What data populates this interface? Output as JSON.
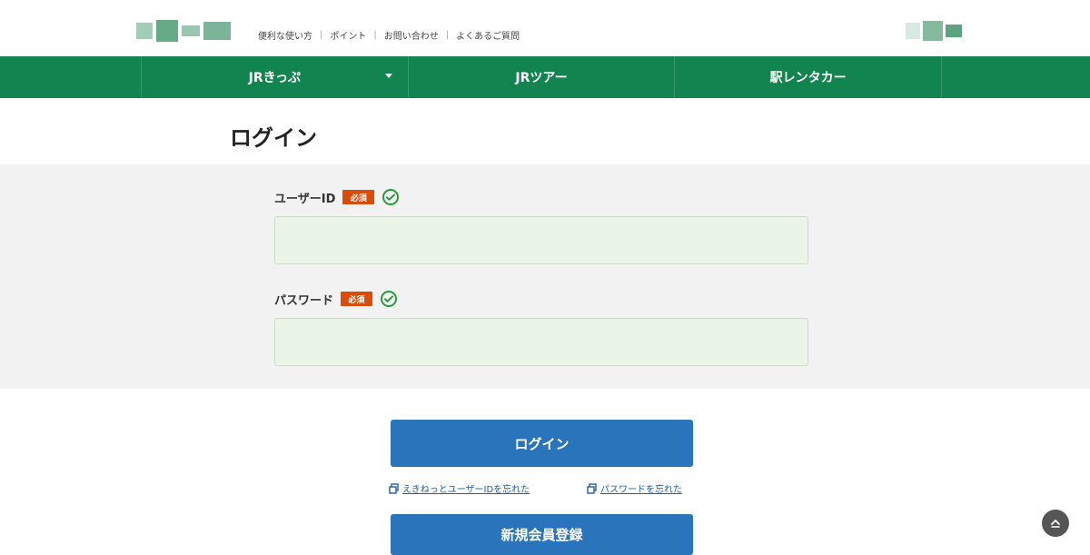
{
  "header": {
    "utility_links": [
      {
        "label": "便利な使い方"
      },
      {
        "label": "ポイント"
      },
      {
        "label": "お問い合わせ"
      },
      {
        "label": "よくあるご質問"
      }
    ]
  },
  "nav": {
    "items": [
      {
        "label": "JRきっぷ",
        "has_dropdown": true
      },
      {
        "label": "JRツアー",
        "has_dropdown": false
      },
      {
        "label": "駅レンタカー",
        "has_dropdown": false
      }
    ]
  },
  "page": {
    "title": "ログイン"
  },
  "form": {
    "user_id": {
      "label": "ユーザーID",
      "required": "必須",
      "value": ""
    },
    "password": {
      "label": "パスワード",
      "required": "必須",
      "value": ""
    }
  },
  "actions": {
    "login_button": "ログイン",
    "forgot_user_id": "えきねっとユーザーIDを忘れた",
    "forgot_password": "パスワードを忘れた",
    "register_button": "新規会員登録"
  },
  "icons": {
    "check": "check-circle-icon",
    "external": "external-link-icon",
    "page_top": "arrow-up-icon"
  },
  "colors": {
    "brand_green": "#12844f",
    "required_orange": "#d94d09",
    "primary_blue": "#2a74bc",
    "input_green": "#eaf5e7"
  }
}
